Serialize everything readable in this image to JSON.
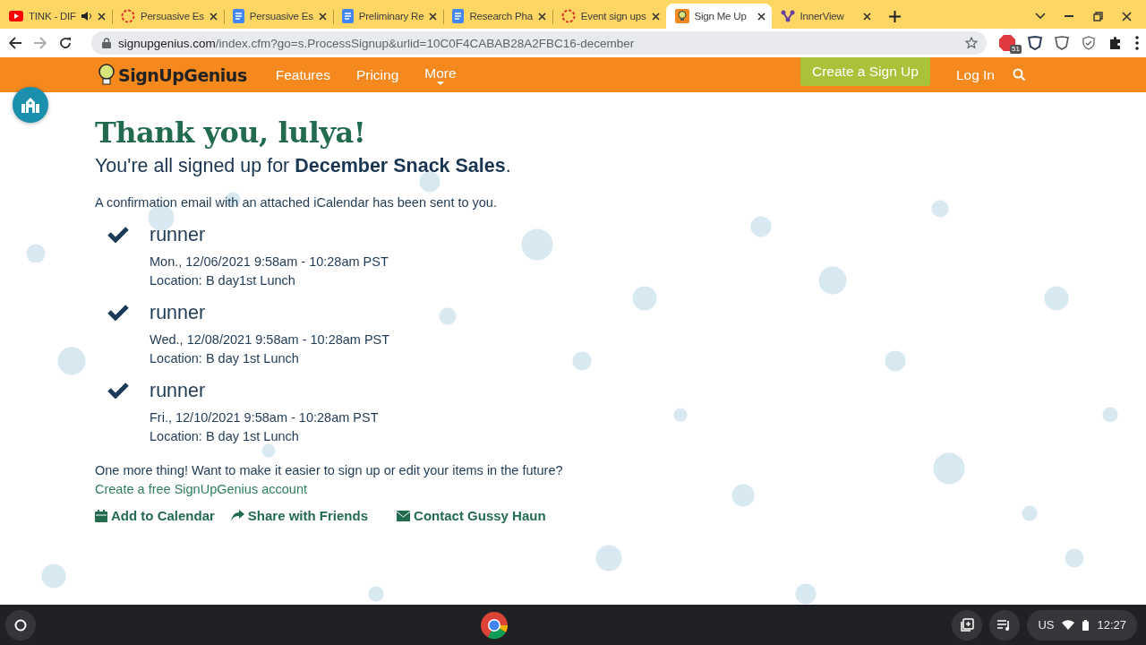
{
  "browser": {
    "tabs": [
      {
        "title": "TINK - DIF",
        "audio": true,
        "selected": false
      },
      {
        "title": "Persuasive Es",
        "audio": false,
        "selected": false
      },
      {
        "title": "Persuasive Es",
        "audio": false,
        "selected": false
      },
      {
        "title": "Preliminary Re",
        "audio": false,
        "selected": false
      },
      {
        "title": "Research Pha",
        "audio": false,
        "selected": false
      },
      {
        "title": "Event sign ups",
        "audio": false,
        "selected": false
      },
      {
        "title": "Sign Me Up",
        "audio": false,
        "selected": true
      },
      {
        "title": "InnerView",
        "audio": false,
        "selected": false
      }
    ],
    "url": {
      "domain": "signupgenius.com",
      "path": "/index.cfm?go=s.ProcessSignup&urlid=10C0F4CABAB28A2FBC16-december"
    },
    "extension_badge": "51"
  },
  "site_nav": {
    "logo": "SignUpGenius",
    "links": [
      "Features",
      "Pricing",
      "More"
    ],
    "create_button": "Create a Sign Up",
    "login": "Log In"
  },
  "page": {
    "heading": "Thank you, lulya!",
    "subheading": "You're all signed up for **December Snack Sales**.",
    "confirmation": "A confirmation email with an attached iCalendar has been sent to you.",
    "slots": [
      {
        "item": "runner",
        "when": "Mon., 12/06/2021 9:58am - 10:28am PST",
        "location": "Location: B day1st Lunch"
      },
      {
        "item": "runner",
        "when": "Wed., 12/08/2021 9:58am - 10:28am PST",
        "location": "Location: B day 1st Lunch"
      },
      {
        "item": "runner",
        "when": "Fri., 12/10/2021 9:58am - 10:28am PST",
        "location": "Location: B day 1st Lunch"
      }
    ],
    "prompt": "One more thing! Want to make it easier to sign up or edit your items in the future?",
    "account_link": "Create a free SignUpGenius account",
    "actions": [
      {
        "kind": "calendar",
        "label": "Add to Calendar"
      },
      {
        "kind": "share",
        "label": "Share with Friends"
      },
      {
        "kind": "email",
        "label": "Contact Gussy Haun"
      }
    ]
  },
  "shelf": {
    "ime": "US",
    "time": "12:27"
  }
}
